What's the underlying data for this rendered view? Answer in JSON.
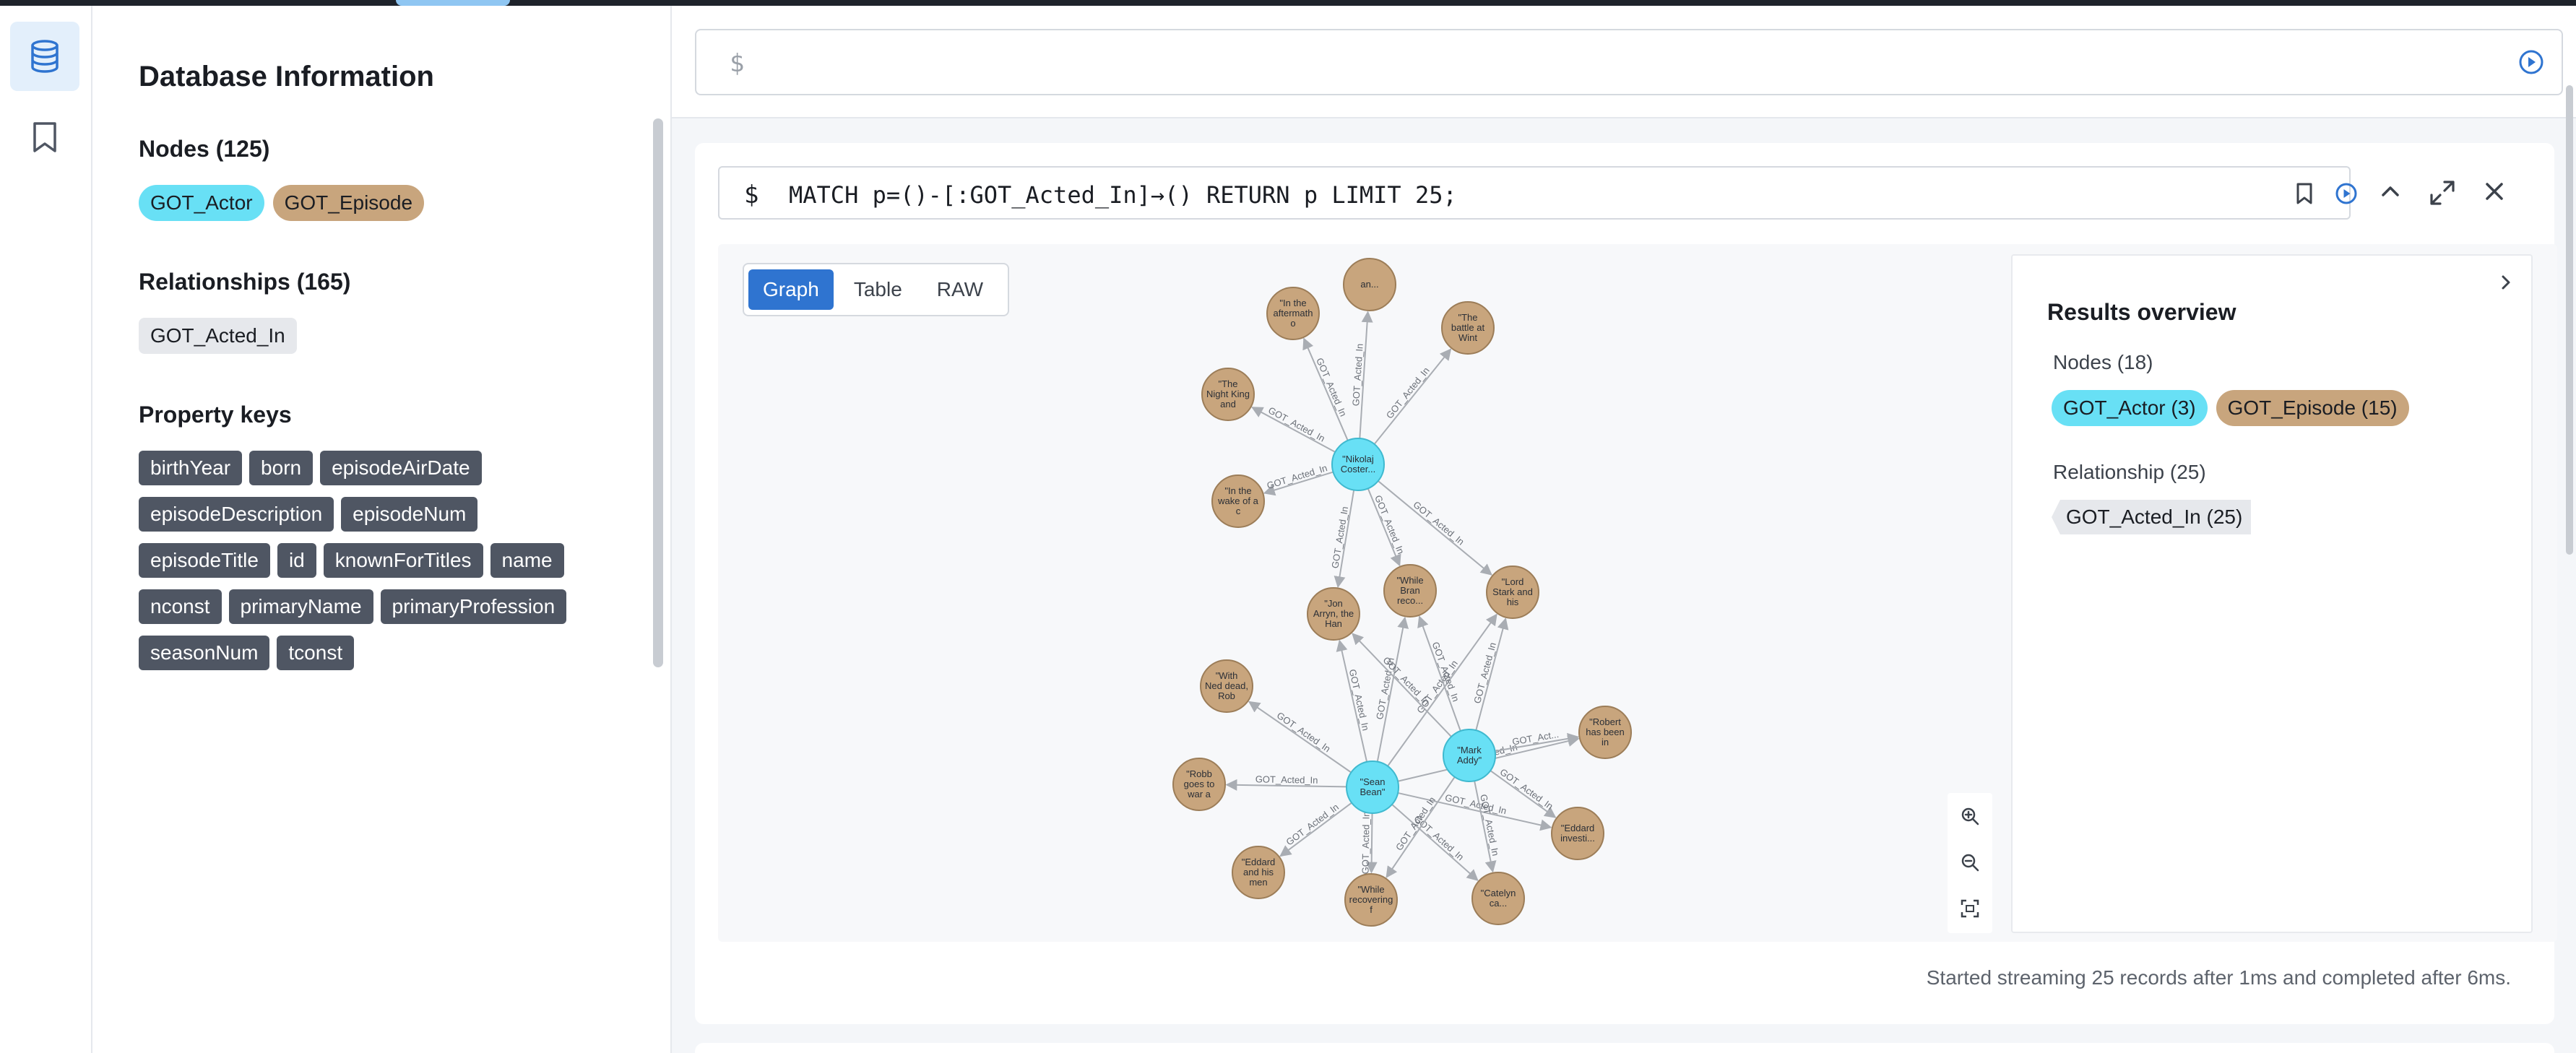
{
  "sidebar": {
    "title": "Database Information",
    "nodes_heading": "Nodes (125)",
    "node_labels": [
      "GOT_Actor",
      "GOT_Episode"
    ],
    "relationships_heading": "Relationships (165)",
    "relationship_types": [
      "GOT_Acted_In"
    ],
    "property_keys_heading": "Property keys",
    "property_keys": [
      "birthYear",
      "born",
      "episodeAirDate",
      "episodeDescription",
      "episodeNum",
      "episodeTitle",
      "id",
      "knownForTitles",
      "name",
      "nconst",
      "primaryName",
      "primaryProfession",
      "seasonNum",
      "tconst"
    ]
  },
  "editor": {
    "prompt": "$"
  },
  "query": {
    "prompt": "$",
    "text": "MATCH p=()-[:GOT_Acted_In]→() RETURN p LIMIT 25;"
  },
  "view_tabs": [
    "Graph",
    "Table",
    "RAW"
  ],
  "active_view": "Graph",
  "overview": {
    "title": "Results overview",
    "nodes_label": "Nodes (18)",
    "node_tags": [
      "GOT_Actor (3)",
      "GOT_Episode (15)"
    ],
    "relationships_label": "Relationship (25)",
    "relationship_tags": [
      "GOT_Acted_In (25)"
    ]
  },
  "status_text": "Started streaming 25 records after 1ms and completed after 6ms.",
  "graph": {
    "edge_label": "GOT_Acted_In",
    "edge_label_short": "GOT_Act...",
    "actors": [
      {
        "id": "nikolaj",
        "lines": [
          "\"Nikolaj",
          "Coster..."
        ]
      },
      {
        "id": "mark",
        "lines": [
          "\"Mark",
          "Addy\""
        ]
      },
      {
        "id": "sean",
        "lines": [
          "\"Sean",
          "Bean\""
        ]
      }
    ],
    "episodes": [
      {
        "id": "e1",
        "lines": [
          "an..."
        ]
      },
      {
        "id": "e2",
        "lines": [
          "\"In the",
          "aftermath",
          "o"
        ]
      },
      {
        "id": "e3",
        "lines": [
          "\"The",
          "battle at",
          "Wint"
        ]
      },
      {
        "id": "e4",
        "lines": [
          "\"The",
          "Night King",
          "and"
        ]
      },
      {
        "id": "e5",
        "lines": [
          "\"In the",
          "wake of a",
          "c"
        ]
      },
      {
        "id": "e6",
        "lines": [
          "\"While",
          "Bran",
          "reco..."
        ]
      },
      {
        "id": "e7",
        "lines": [
          "\"Lord",
          "Stark and",
          "his"
        ]
      },
      {
        "id": "e8",
        "lines": [
          "\"Jon",
          "Arryn, the",
          "Han"
        ]
      },
      {
        "id": "e9",
        "lines": [
          "\"With",
          "Ned dead,",
          "Rob"
        ]
      },
      {
        "id": "e10",
        "lines": [
          "\"Robert",
          "has been",
          "in"
        ]
      },
      {
        "id": "e11",
        "lines": [
          "\"Robb",
          "goes to",
          "war a"
        ]
      },
      {
        "id": "e12",
        "lines": [
          "\"Eddard",
          "investi..."
        ]
      },
      {
        "id": "e13",
        "lines": [
          "\"Eddard",
          "and his",
          "men"
        ]
      },
      {
        "id": "e14",
        "lines": [
          "\"While",
          "recovering",
          "f"
        ]
      },
      {
        "id": "e15",
        "lines": [
          "\"Catelyn",
          "ca..."
        ]
      }
    ],
    "colors": {
      "actor": "#68e0f5",
      "actor_stroke": "#3fb9cf",
      "episode": "#c8a57d",
      "episode_stroke": "#9c7d58",
      "edge": "#a9adb3"
    }
  }
}
